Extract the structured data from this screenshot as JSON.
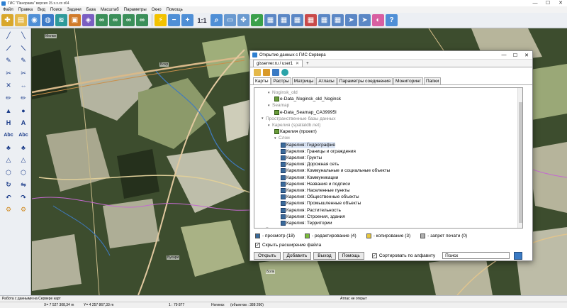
{
  "app": {
    "title": "ГИС \"Панорама\" версия 15.x.x.xx x64",
    "window_controls": [
      "—",
      "☐",
      "✕"
    ]
  },
  "menu": [
    "Файл",
    "Правка",
    "Вид",
    "Поиск",
    "Задачи",
    "База",
    "Масштаб",
    "Параметры",
    "Окно",
    "Помощь"
  ],
  "toolbar": {
    "zoom_label": "1:1"
  },
  "map": {
    "labels": [
      "Мелки",
      "Бохр",
      "Болк",
      "Букари"
    ]
  },
  "dialog": {
    "title": "Открытие данных с ГИС Сервера",
    "controls": [
      "—",
      "☐",
      "✕"
    ],
    "connection_tab": "gisserver.ru / user1",
    "add_tab": "+",
    "subtabs": [
      "Карты",
      "Растры",
      "Матрицы",
      "Атласы",
      "Параметры соединения",
      "Мониторинг",
      "Папки"
    ],
    "active_subtab": "Карты",
    "tree": [
      {
        "text": "Noginsk_old",
        "level": 1,
        "kind": "folder",
        "gray": true,
        "arrow": "v"
      },
      {
        "text": "e-Data_Noginsk_old_Noginsk",
        "level": 2,
        "kind": "map"
      },
      {
        "text": "Seamap",
        "level": 1,
        "kind": "folder",
        "gray": true,
        "arrow": "v"
      },
      {
        "text": "e-Data_Seamap_CA39995I",
        "level": 2,
        "kind": "map"
      },
      {
        "text": "Пространственные базы данных",
        "level": 0,
        "kind": "folder",
        "gray": true,
        "arrow": "v"
      },
      {
        "text": "Карелия (spatialdb.net)",
        "level": 1,
        "kind": "folder",
        "gray": true,
        "arrow": "v"
      },
      {
        "text": "Карелия (проект)",
        "level": 2,
        "kind": "map"
      },
      {
        "text": "Слои",
        "level": 2,
        "kind": "folder",
        "gray": true,
        "arrow": "v"
      },
      {
        "text": "Карелия: Гидрография",
        "level": 3,
        "kind": "layer",
        "selected": true
      },
      {
        "text": "Карелия: Границы и ограждения",
        "level": 3,
        "kind": "layer"
      },
      {
        "text": "Карелия: Грунты",
        "level": 3,
        "kind": "layer"
      },
      {
        "text": "Карелия: Дорожная сеть",
        "level": 3,
        "kind": "layer"
      },
      {
        "text": "Карелия: Коммунальные и социальные объекты",
        "level": 3,
        "kind": "layer"
      },
      {
        "text": "Карелия: Коммуникации",
        "level": 3,
        "kind": "layer"
      },
      {
        "text": "Карелия: Названия и подписи",
        "level": 3,
        "kind": "layer"
      },
      {
        "text": "Карелия: Населенные пункты",
        "level": 3,
        "kind": "layer"
      },
      {
        "text": "Карелия: Общественные объекты",
        "level": 3,
        "kind": "layer"
      },
      {
        "text": "Карелия: Промышленные объекты",
        "level": 3,
        "kind": "layer"
      },
      {
        "text": "Карелия: Растительность",
        "level": 3,
        "kind": "layer"
      },
      {
        "text": "Карелия: Строения, здания",
        "level": 3,
        "kind": "layer"
      },
      {
        "text": "Карелия: Территории",
        "level": 3,
        "kind": "layer"
      },
      {
        "text": "Россия",
        "level": 0,
        "kind": "folder",
        "gray": true,
        "arrow": ">"
      }
    ],
    "legend": [
      {
        "label": "- просмотр (18)",
        "color": "#3a6a9a"
      },
      {
        "label": "- редактирование (4)",
        "color": "#7bbd3a"
      },
      {
        "label": "- копирование (3)",
        "color": "#e8c840"
      },
      {
        "label": "- запрет печати (0)",
        "color": "#b0b0b0"
      }
    ],
    "hide_extension": "Скрыть расширение файла",
    "buttons": {
      "open": "Открыть",
      "add": "Добавить",
      "exit": "Выход",
      "help": "Помощь"
    },
    "sort_label": "Сортировать по алфавиту",
    "search_value": "Поиск"
  },
  "status": {
    "left_message": "Работа с данными на Сервере карт",
    "atlas_message": "Атлас не открыт",
    "coord_x": "X= 7 527 308,34 m",
    "coord_y": "Y= 4 257 867,33 m",
    "scale": "1 : 79 877",
    "map_name": "Ногинск",
    "objects": "(объектов : 388 260)"
  },
  "colors": {
    "accent": "#2d7fd1",
    "selection": "#dbe5f5"
  }
}
